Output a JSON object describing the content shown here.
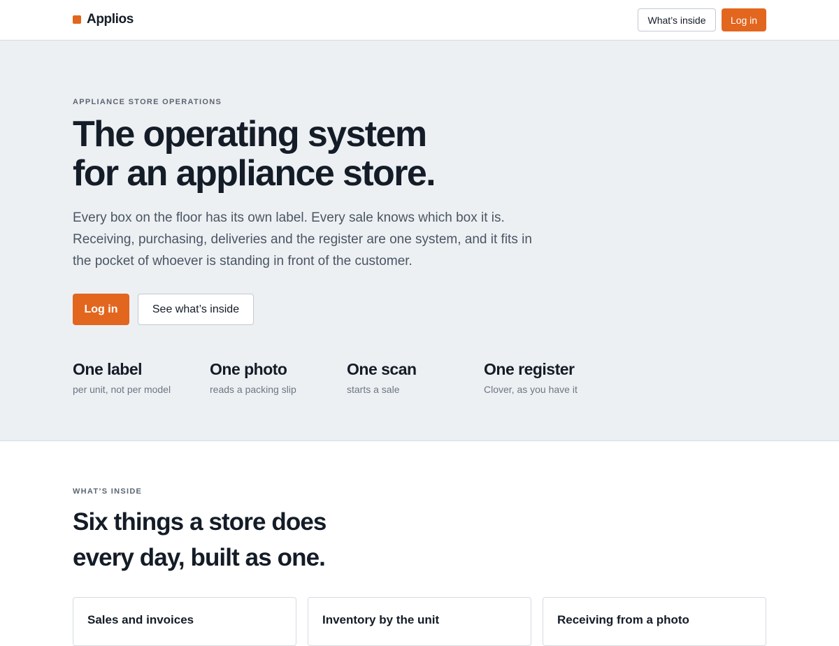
{
  "header": {
    "brand_name": "Applios",
    "brand_color": "#e2661e",
    "nav": {
      "whats_inside_label": "What’s inside",
      "login_label": "Log in"
    }
  },
  "hero": {
    "eyebrow": "APPLIANCE STORE OPERATIONS",
    "headline_line1": "The operating system",
    "headline_line2": "for an appliance store.",
    "lede": "Every box on the floor has its own label. Every sale knows which box it is. Receiving, purchasing, deliveries and the register are one system, and it fits in the pocket of whoever is standing in front of the customer.",
    "cta_primary": "Log in",
    "cta_secondary": "See what’s inside",
    "stats": [
      {
        "title": "One label",
        "sub": "per unit, not per model"
      },
      {
        "title": "One photo",
        "sub": "reads a packing slip"
      },
      {
        "title": "One scan",
        "sub": "starts a sale"
      },
      {
        "title": "One register",
        "sub": "Clover, as you have it"
      }
    ]
  },
  "features": {
    "eyebrow": "WHAT’S INSIDE",
    "title_line1": "Six things a store does",
    "title_line2": "every day, built as one.",
    "cards": [
      {
        "title": "Sales and invoices"
      },
      {
        "title": "Inventory by the unit"
      },
      {
        "title": "Receiving from a photo"
      }
    ]
  }
}
